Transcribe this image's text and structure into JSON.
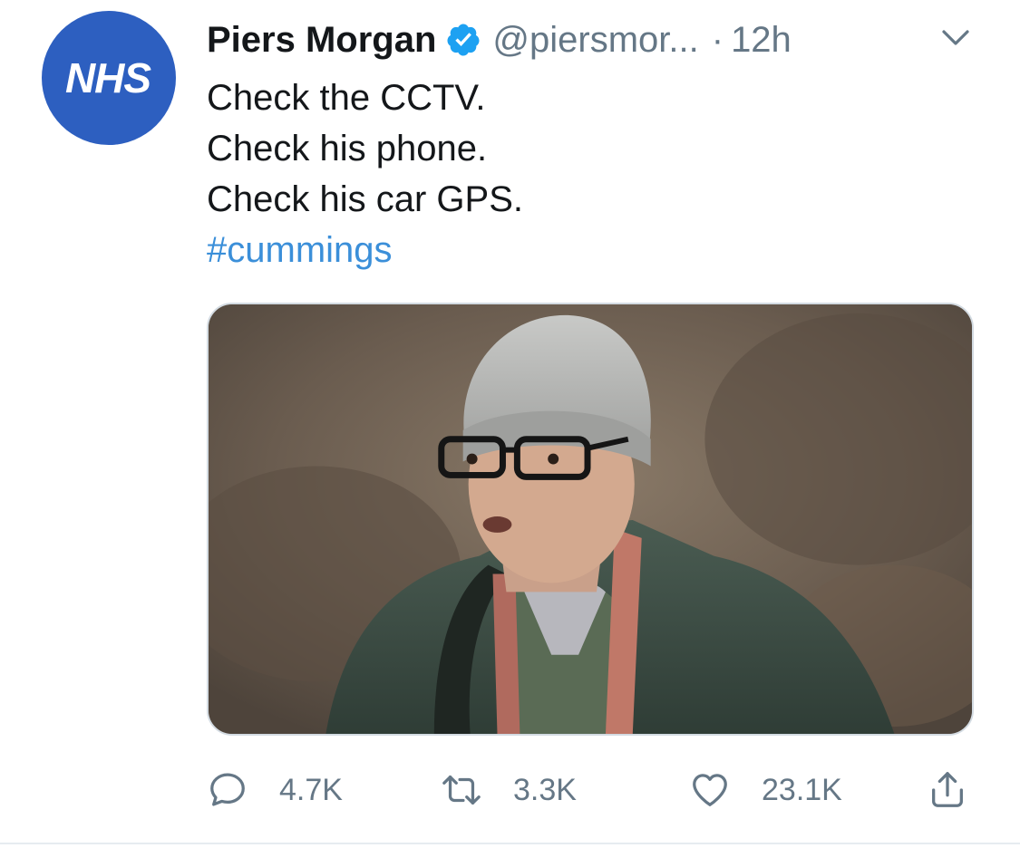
{
  "avatar": {
    "text": "NHS",
    "color": "#2d5fc0"
  },
  "tweet": {
    "author_name": "Piers Morgan",
    "verified_icon": "verified-badge-icon",
    "handle": "@piersmor...",
    "separator": "·",
    "time": "12h",
    "menu_icon": "chevron-down-icon",
    "lines": [
      "Check the CCTV.",
      "Check his phone.",
      "Check his car GPS."
    ],
    "hashtag": "#cummings",
    "hashtag_color": "#3b8fd9"
  },
  "actions": {
    "reply": {
      "icon": "reply-icon",
      "count": "4.7K"
    },
    "retweet": {
      "icon": "retweet-icon",
      "count": "3.3K"
    },
    "like": {
      "icon": "heart-icon",
      "count": "23.1K"
    },
    "share": {
      "icon": "share-icon"
    }
  },
  "colors": {
    "text": "#14171a",
    "secondary": "#657786",
    "verified": "#1da1f2"
  }
}
